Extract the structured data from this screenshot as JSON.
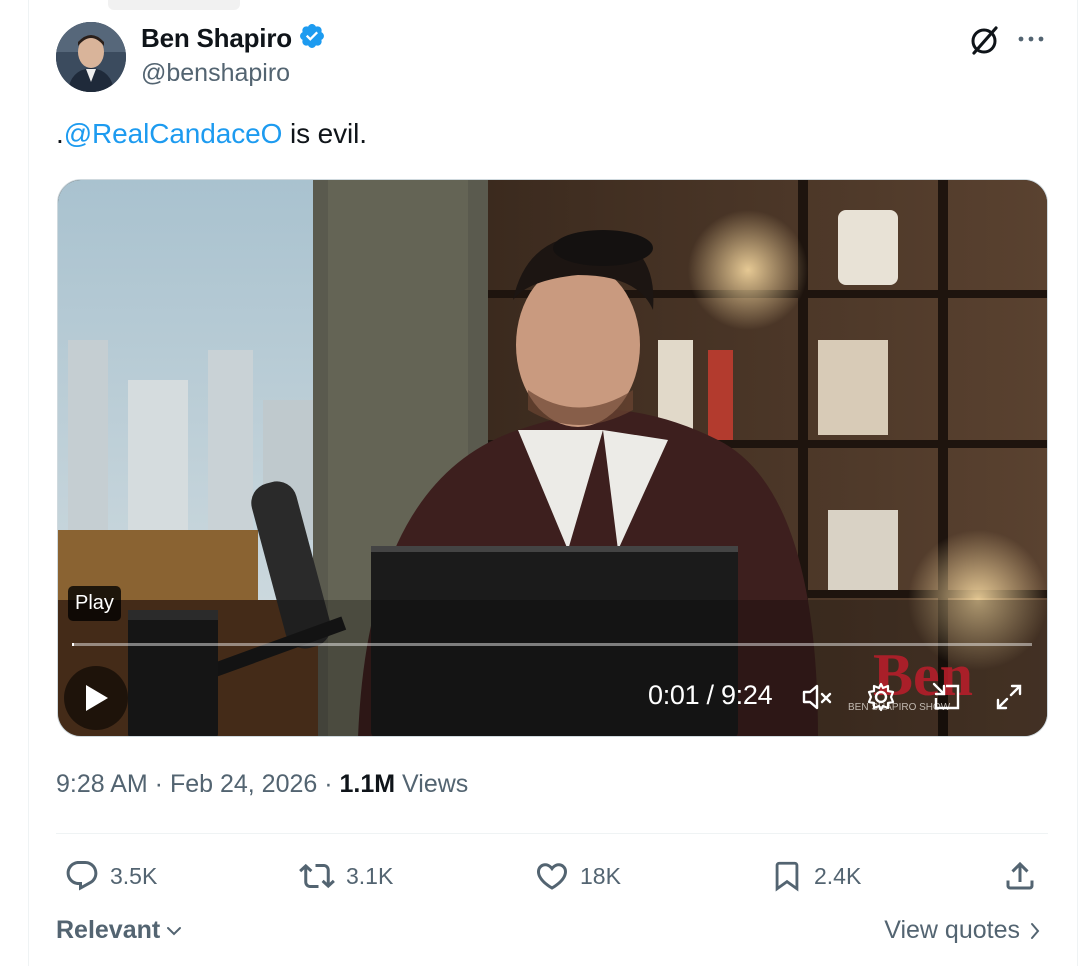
{
  "author": {
    "name": "Ben Shapiro",
    "handle": "@benshapiro",
    "verified": true
  },
  "tweet": {
    "prefix": ".",
    "mention": "@RealCandaceO",
    "text_rest": " is evil."
  },
  "video": {
    "play_tooltip": "Play",
    "current_time": "0:01",
    "separator": " / ",
    "duration": "9:24",
    "progress_fraction": 0.0018,
    "watermark": "Ben",
    "watermark_sub": "BEN SHAPIRO SHOW"
  },
  "meta": {
    "time": "9:28 AM",
    "dot1": " · ",
    "date": "Feb 24, 2026",
    "dot2": " · ",
    "views_count": "1.1M",
    "views_label": " Views"
  },
  "actions": {
    "replies": "3.5K",
    "reposts": "3.1K",
    "likes": "18K",
    "bookmarks": "2.4K"
  },
  "footer": {
    "sort_label": "Relevant",
    "view_quotes_label": "View quotes"
  },
  "colors": {
    "accent": "#1d9bf0",
    "text_secondary": "#536471",
    "text_primary": "#0f1419"
  },
  "icons": [
    "verified-badge-icon",
    "grok-icon",
    "more-icon",
    "play-icon",
    "mute-icon",
    "settings-icon",
    "pip-icon",
    "fullscreen-icon",
    "reply-icon",
    "repost-icon",
    "like-icon",
    "bookmark-icon",
    "share-icon",
    "chevron-down-icon",
    "chevron-right-icon"
  ]
}
